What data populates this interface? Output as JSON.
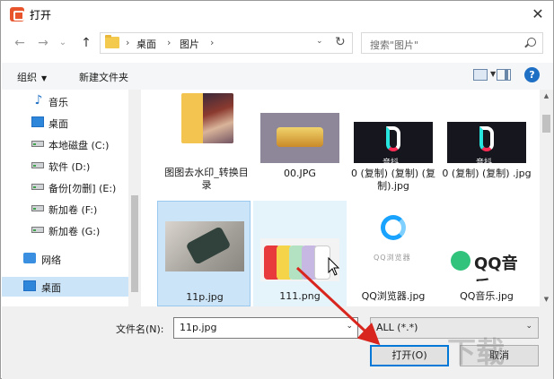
{
  "window": {
    "title": "打开",
    "close_glyph": "✕"
  },
  "nav": {
    "back_glyph": "←",
    "forward_glyph": "→",
    "dropdown_glyph": "⌄",
    "up_glyph": "↑",
    "refresh_glyph": "↻",
    "breadcrumb": [
      "桌面",
      "图片"
    ],
    "sep_glyph": "›",
    "addr_dd_glyph": "⌄"
  },
  "search": {
    "placeholder": "搜索\"图片\""
  },
  "toolbar": {
    "organize": "组织",
    "new_folder": "新建文件夹",
    "help": "?"
  },
  "sidebar": {
    "items": [
      {
        "label": "音乐",
        "icon": "music-icon"
      },
      {
        "label": "桌面",
        "icon": "desktop-icon"
      },
      {
        "label": "本地磁盘 (C:)",
        "icon": "drive-icon"
      },
      {
        "label": "软件 (D:)",
        "icon": "drive-icon"
      },
      {
        "label": "备份[勿删] (E:)",
        "icon": "drive-icon"
      },
      {
        "label": "新加卷 (F:)",
        "icon": "drive-icon"
      },
      {
        "label": "新加卷 (G:)",
        "icon": "drive-icon"
      },
      {
        "label": "网络",
        "icon": "network-icon"
      },
      {
        "label": "桌面",
        "icon": "desktop-icon",
        "selected": true
      }
    ]
  },
  "files": [
    {
      "name": "图图去水印_转换目录",
      "kind": "folder"
    },
    {
      "name": "00.JPG",
      "kind": "image"
    },
    {
      "name": "0 (复制) (复制) (复制).jpg",
      "kind": "image"
    },
    {
      "name": "0 (复制) (复制) .jpg",
      "kind": "image"
    },
    {
      "name": "11p.jpg",
      "kind": "image",
      "selected": true
    },
    {
      "name": "111.png",
      "kind": "image",
      "hover": true
    },
    {
      "name": "QQ浏览器.jpg",
      "kind": "image"
    },
    {
      "name": "QQ音乐.jpg",
      "kind": "image"
    }
  ],
  "thumb_text": {
    "tiktok": "音抖",
    "qqbrowser": "QQ浏览器",
    "qqmusic": "QQ音乐"
  },
  "bottom": {
    "filename_label": "文件名(N):",
    "filename_value": "11p.jpg",
    "filetype_value": "ALL (*.*)",
    "open_button": "打开(O)",
    "cancel_button": "取消",
    "dd_glyph": "⌄"
  },
  "colors": {
    "selection": "#cce4f7",
    "accent": "#0078d7",
    "annotation_arrow": "#d8251d"
  }
}
